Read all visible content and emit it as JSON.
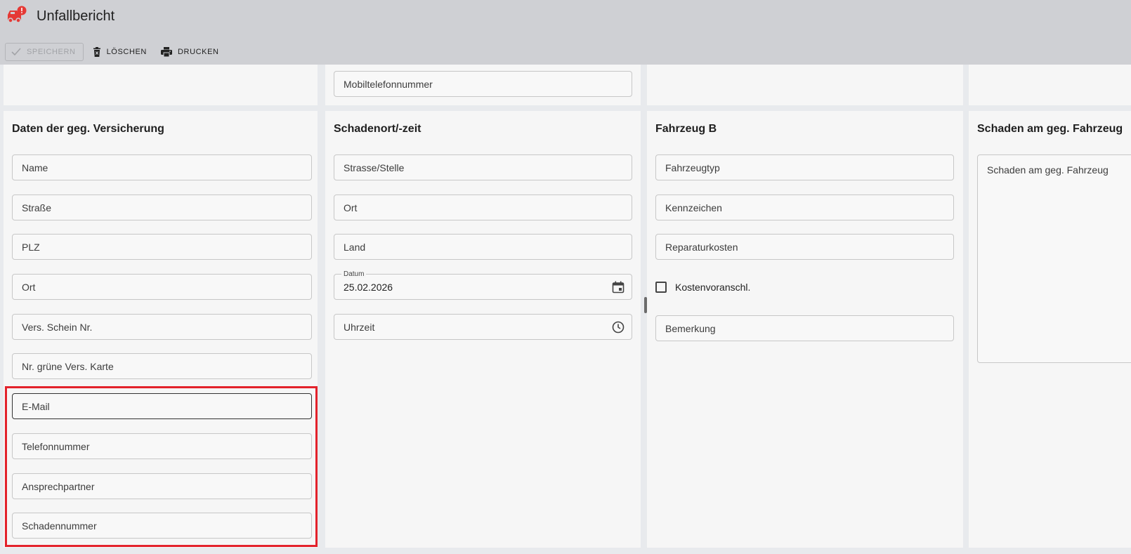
{
  "app": {
    "title": "Unfallbericht",
    "icon": "car-crash-alert-icon",
    "accent_color": "#e53935"
  },
  "toolbar": {
    "save_label": "SPEICHERN",
    "delete_label": "LÖSCHEN",
    "print_label": "DRUCKEN"
  },
  "top_row": {
    "col2_field": "Mobiltelefonnummer"
  },
  "insurance_panel": {
    "title": "Daten der geg. Versicherung",
    "fields": [
      "Name",
      "Straße",
      "PLZ",
      "Ort",
      "Vers. Schein Nr.",
      "Nr. grüne Vers. Karte",
      "E-Mail",
      "Telefonnummer",
      "Ansprechpartner",
      "Schadennummer"
    ]
  },
  "location_panel": {
    "title": "Schadenort/-zeit",
    "street": "Strasse/Stelle",
    "city": "Ort",
    "country": "Land",
    "date_label": "Datum",
    "date_value": "25.02.2026",
    "time": "Uhrzeit"
  },
  "vehicle_panel": {
    "title": "Fahrzeug B",
    "type": "Fahrzeugtyp",
    "plate": "Kennzeichen",
    "repair_cost": "Reparaturkosten",
    "estimate_checkbox": "Kostenvoranschl.",
    "remark": "Bemerkung"
  },
  "damage_panel": {
    "title": "Schaden am geg. Fahrzeug",
    "textarea_placeholder": "Schaden am geg. Fahrzeug"
  },
  "highlight_color": "#e3222b"
}
